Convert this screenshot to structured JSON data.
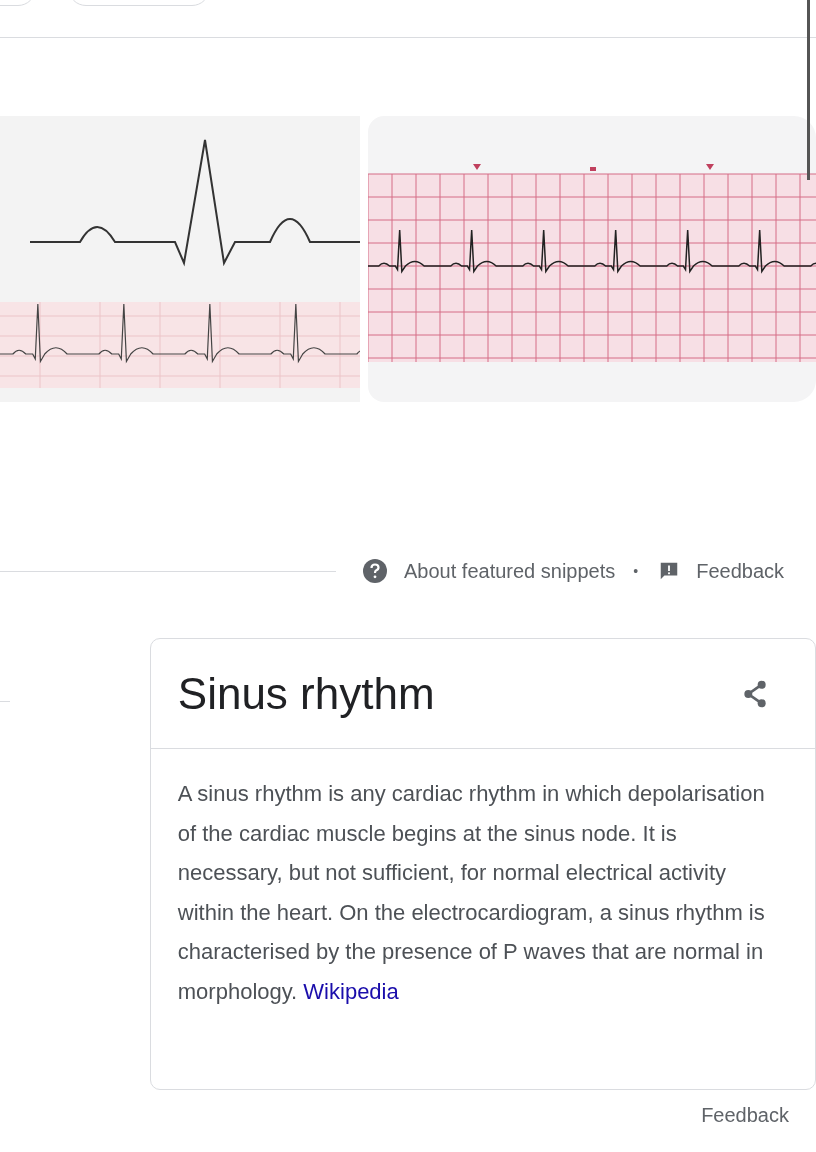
{
  "snippet_footer": {
    "about_label": "About featured snippets",
    "separator": "•",
    "feedback_label": "Feedback"
  },
  "knowledge_panel": {
    "title": "Sinus rhythm",
    "description": "A sinus rhythm is any cardiac rhythm in which depolarisation of the cardiac muscle begins at the sinus node. It is necessary, but not sufficient, for normal electrical activity within the heart. On the electrocardiogram, a sinus rhythm is characterised by the presence of P waves that are normal in morphology.",
    "source_link": "Wikipedia"
  },
  "footer_feedback": "Feedback"
}
